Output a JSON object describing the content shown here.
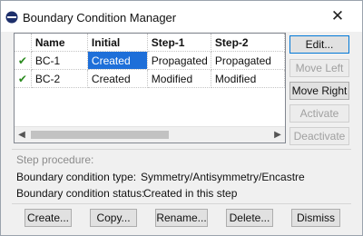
{
  "window": {
    "title": "Boundary Condition Manager",
    "close_glyph": "✕"
  },
  "table": {
    "headers": {
      "name": "Name",
      "initial": "Initial",
      "step1": "Step-1",
      "step2": "Step-2"
    },
    "rows": [
      {
        "check": "✔",
        "name": "BC-1",
        "initial": "Created",
        "step1": "Propagated",
        "step2": "Propagated"
      },
      {
        "check": "✔",
        "name": "BC-2",
        "initial": "Created",
        "step1": "Modified",
        "step2": "Modified"
      }
    ]
  },
  "side_buttons": {
    "edit": "Edit...",
    "move_left": "Move Left",
    "move_right": "Move Right",
    "activate": "Activate",
    "deactivate": "Deactivate"
  },
  "info": {
    "step_procedure_label": "Step procedure:",
    "type_label": "Boundary condition type:",
    "type_value": "Symmetry/Antisymmetry/Encastre",
    "status_label": "Boundary condition status:",
    "status_value": "Created in this step"
  },
  "bottom_buttons": {
    "create": "Create...",
    "copy": "Copy...",
    "rename": "Rename...",
    "delete": "Delete...",
    "dismiss": "Dismiss"
  },
  "colors": {
    "selection": "#1e6fd9",
    "check": "#2a8a1e",
    "focus_border": "#0078d7"
  },
  "icons": {
    "app": "abaqus-app-icon",
    "close": "close-icon",
    "check": "check-icon",
    "scroll_left": "arrow-left-icon",
    "scroll_right": "arrow-right-icon"
  }
}
